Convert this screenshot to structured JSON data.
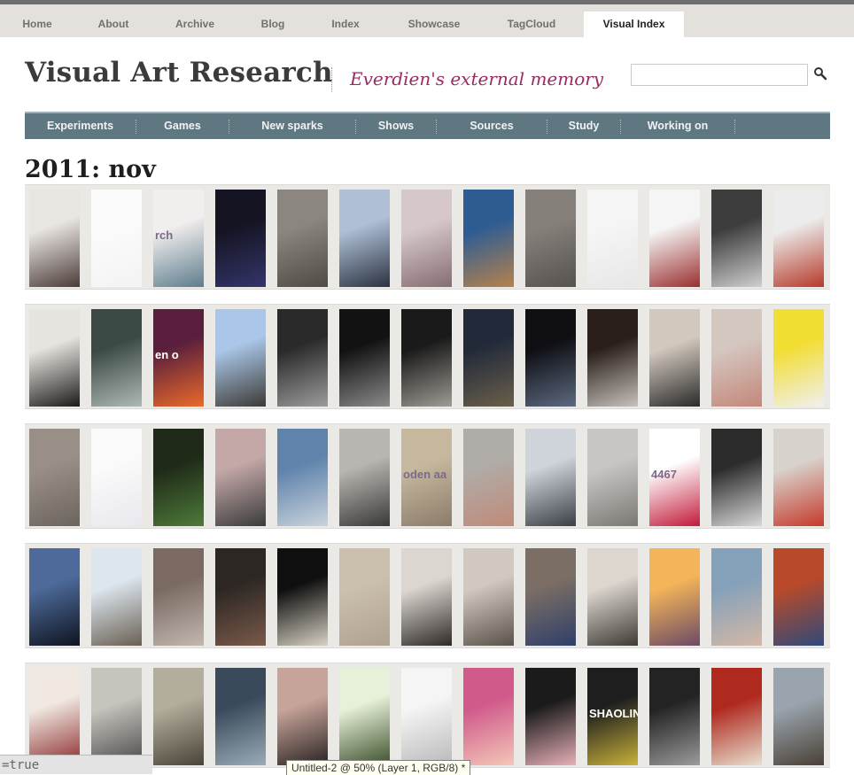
{
  "topnav": {
    "tabs": [
      {
        "label": "Home",
        "active": false
      },
      {
        "label": "About",
        "active": false
      },
      {
        "label": "Archive",
        "active": false
      },
      {
        "label": "Blog",
        "active": false
      },
      {
        "label": "Index",
        "active": false
      },
      {
        "label": "Showcase",
        "active": false
      },
      {
        "label": "TagCloud",
        "active": false
      },
      {
        "label": "Visual Index",
        "active": true
      }
    ]
  },
  "header": {
    "site_title": "Visual Art Research",
    "tagline": "Everdien's external memory",
    "search_value": "",
    "search_icon": "magnifier-icon"
  },
  "categories": [
    "Experiments",
    "Games",
    "New sparks",
    "Shows",
    "Sources",
    "Study",
    "Working on"
  ],
  "archive": {
    "heading": "2011: nov",
    "rows": [
      [
        {
          "c1": "#e9e6e2",
          "c2": "#4a3b38",
          "text": "",
          "dark": false
        },
        {
          "c1": "#fbfbfb",
          "c2": "#f3f3f3",
          "text": "",
          "dark": false
        },
        {
          "c1": "#f1eeee",
          "c2": "#5d7d8c",
          "text": "rch",
          "dark": false
        },
        {
          "c1": "#151423",
          "c2": "#33356b",
          "text": "",
          "dark": true
        },
        {
          "c1": "#8c8680",
          "c2": "#4f4a45",
          "text": "",
          "dark": true
        },
        {
          "c1": "#aebfd6",
          "c2": "#2b3240",
          "text": "",
          "dark": true
        },
        {
          "c1": "#d6c8c9",
          "c2": "#866c72",
          "text": "",
          "dark": false
        },
        {
          "c1": "#2d5c93",
          "c2": "#b5824d",
          "text": "",
          "dark": true
        },
        {
          "c1": "#85807a",
          "c2": "#56524f",
          "text": "",
          "dark": true
        },
        {
          "c1": "#f5f5f5",
          "c2": "#e7e7e7",
          "text": "",
          "dark": false
        },
        {
          "c1": "#f5f5f5",
          "c2": "#9a2f2f",
          "text": "",
          "dark": false
        },
        {
          "c1": "#3d3d3d",
          "c2": "#cfcfcf",
          "text": "",
          "dark": true
        },
        {
          "c1": "#ececec",
          "c2": "#b63a2a",
          "text": "",
          "dark": false
        }
      ],
      [
        {
          "c1": "#e6e4df",
          "c2": "#1e1a1a",
          "text": "",
          "dark": false
        },
        {
          "c1": "#3c4a46",
          "c2": "#aeb9b5",
          "text": "",
          "dark": true
        },
        {
          "c1": "#5a1f3c",
          "c2": "#ea6a2b",
          "text": "en o",
          "dark": true
        },
        {
          "c1": "#aac6e8",
          "c2": "#3c3a36",
          "text": "",
          "dark": true
        },
        {
          "c1": "#2a2a2a",
          "c2": "#9c9c9c",
          "text": "",
          "dark": true
        },
        {
          "c1": "#121212",
          "c2": "#8a8a8a",
          "text": "",
          "dark": true
        },
        {
          "c1": "#1a1a1a",
          "c2": "#9f9b94",
          "text": "",
          "dark": true
        },
        {
          "c1": "#222a3a",
          "c2": "#6b5f4a",
          "text": "",
          "dark": true
        },
        {
          "c1": "#0f0f14",
          "c2": "#5d6a80",
          "text": "",
          "dark": true
        },
        {
          "c1": "#2a1f1a",
          "c2": "#c7c2bc",
          "text": "",
          "dark": true
        },
        {
          "c1": "#d2c8bd",
          "c2": "#2a2a2a",
          "text": "",
          "dark": false
        },
        {
          "c1": "#d4c7c0",
          "c2": "#c4877a",
          "text": "",
          "dark": false
        },
        {
          "c1": "#f2dd33",
          "c2": "#f0f0f0",
          "text": "",
          "dark": false
        }
      ],
      [
        {
          "c1": "#9a8f86",
          "c2": "#6b645e",
          "text": "",
          "dark": true
        },
        {
          "c1": "#fafafa",
          "c2": "#e8e8ee",
          "text": "",
          "dark": false
        },
        {
          "c1": "#1f2a18",
          "c2": "#4e7a3a",
          "text": "",
          "dark": true
        },
        {
          "c1": "#c4a8a8",
          "c2": "#3b3b3b",
          "text": "",
          "dark": true
        },
        {
          "c1": "#5f83ab",
          "c2": "#c9d3dd",
          "text": "",
          "dark": true
        },
        {
          "c1": "#b9b5b0",
          "c2": "#393939",
          "text": "",
          "dark": false
        },
        {
          "c1": "#c6b79f",
          "c2": "#8a7c68",
          "text": "oden aa",
          "dark": false
        },
        {
          "c1": "#b0aca7",
          "c2": "#c08a7a",
          "text": "",
          "dark": false
        },
        {
          "c1": "#cfd4da",
          "c2": "#3a3f45",
          "text": "",
          "dark": false
        },
        {
          "c1": "#c8c6c3",
          "c2": "#7b7874",
          "text": "",
          "dark": false
        },
        {
          "c1": "#ffffff",
          "c2": "#c21a3a",
          "text": "4467",
          "dark": false
        },
        {
          "c1": "#2c2c2c",
          "c2": "#d8d8d8",
          "text": "",
          "dark": true
        },
        {
          "c1": "#d8d2cc",
          "c2": "#c53a2a",
          "text": "",
          "dark": false
        }
      ],
      [
        {
          "c1": "#4d6a9a",
          "c2": "#0f1420",
          "text": "",
          "dark": true
        },
        {
          "c1": "#dce6ee",
          "c2": "#6a5f53",
          "text": "",
          "dark": false
        },
        {
          "c1": "#7a6a62",
          "c2": "#c2b8b0",
          "text": "",
          "dark": true
        },
        {
          "c1": "#2d2724",
          "c2": "#7a5a4a",
          "text": "",
          "dark": true
        },
        {
          "c1": "#0f0f0f",
          "c2": "#d8d2c4",
          "text": "",
          "dark": true
        },
        {
          "c1": "#cbbfae",
          "c2": "#b0a290",
          "text": "",
          "dark": false
        },
        {
          "c1": "#dbd6d0",
          "c2": "#2e2a27",
          "text": "",
          "dark": false
        },
        {
          "c1": "#d1c8bf",
          "c2": "#5a524a",
          "text": "",
          "dark": false
        },
        {
          "c1": "#7b6e64",
          "c2": "#2f3f6a",
          "text": "",
          "dark": true
        },
        {
          "c1": "#dcd6cf",
          "c2": "#3f3a35",
          "text": "",
          "dark": false
        },
        {
          "c1": "#f3b45a",
          "c2": "#6b4a64",
          "text": "",
          "dark": true
        },
        {
          "c1": "#85a1ba",
          "c2": "#d4b8a6",
          "text": "",
          "dark": true
        },
        {
          "c1": "#b84a2a",
          "c2": "#2f4a7a",
          "text": "",
          "dark": true
        }
      ],
      [
        {
          "c1": "#f1e8e2",
          "c2": "#8a2b2b",
          "text": "",
          "dark": false
        },
        {
          "c1": "#c7c3bd",
          "c2": "#4a4a4a",
          "text": "",
          "dark": false
        },
        {
          "c1": "#b2ad9c",
          "c2": "#494438",
          "text": "",
          "dark": true
        },
        {
          "c1": "#3b4a5a",
          "c2": "#9aabb8",
          "text": "",
          "dark": true
        },
        {
          "c1": "#c7a49a",
          "c2": "#2a2322",
          "text": "",
          "dark": false
        },
        {
          "c1": "#e7f0d8",
          "c2": "#3b4f2a",
          "text": "",
          "dark": false
        },
        {
          "c1": "#f5f5f5",
          "c2": "#b9b9b9",
          "text": "",
          "dark": false
        },
        {
          "c1": "#d05a8a",
          "c2": "#f3c7b8",
          "text": "",
          "dark": false
        },
        {
          "c1": "#1b1b1b",
          "c2": "#e7b0b8",
          "text": "",
          "dark": true
        },
        {
          "c1": "#1e1e1e",
          "c2": "#c7b23a",
          "text": "SHAOLIN",
          "dark": true
        },
        {
          "c1": "#232323",
          "c2": "#9b9b9b",
          "text": "",
          "dark": true
        },
        {
          "c1": "#b0291f",
          "c2": "#e7e0cf",
          "text": "",
          "dark": true
        },
        {
          "c1": "#9aa4ae",
          "c2": "#4a4036",
          "text": "",
          "dark": false
        }
      ]
    ]
  },
  "overlay": {
    "status_text": "=true",
    "tooltip_text": "Untitled-2 @ 50% (Layer 1, RGB/8) *"
  }
}
